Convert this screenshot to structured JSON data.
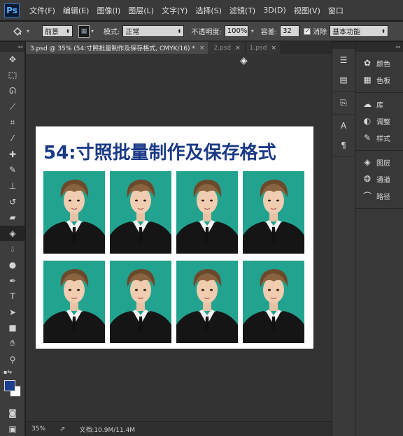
{
  "app": {
    "logo": "Ps",
    "menu": [
      "文件(F)",
      "编辑(E)",
      "图像(I)",
      "图层(L)",
      "文字(Y)",
      "选择(S)",
      "滤镜(T)",
      "3D(D)",
      "视图(V)",
      "窗口"
    ]
  },
  "options": {
    "tool_icon": "paint-bucket-icon",
    "fill_source": "前景",
    "mode_label": "模式:",
    "mode_value": "正常",
    "opacity_label": "不透明度:",
    "opacity_value": "100%",
    "tolerance_label": "容差:",
    "tolerance_value": "32",
    "antialias_label": "消除",
    "workspace": "基本功能"
  },
  "tabs": [
    {
      "label": "3.psd @ 35% (54:寸照批量制作及保存格式, CMYK/16) *",
      "close": "×",
      "active": true
    },
    {
      "label": "2.psd",
      "close": "×",
      "active": false
    },
    {
      "label": "1.psd",
      "close": "×",
      "active": false
    }
  ],
  "document": {
    "title": "54:寸照批量制作及保存格式",
    "photo_count": 8,
    "background_color": "#22a38f",
    "title_color": "#1a3a86"
  },
  "status": {
    "zoom": "35%",
    "doc_size": "文档:10.9M/11.4M"
  },
  "colors": {
    "foreground": "#1b3f8c",
    "background": "#ffffff"
  },
  "panels": {
    "group1": [
      {
        "icon": "palette-icon",
        "label": "颜色"
      },
      {
        "icon": "swatches-icon",
        "label": "色板"
      }
    ],
    "group2": [
      {
        "icon": "library-icon",
        "label": "库"
      },
      {
        "icon": "adjustments-icon",
        "label": "调整"
      },
      {
        "icon": "styles-icon",
        "label": "样式"
      }
    ],
    "group3": [
      {
        "icon": "layers-icon",
        "label": "图层"
      },
      {
        "icon": "channels-icon",
        "label": "通道"
      },
      {
        "icon": "paths-icon",
        "label": "路径"
      }
    ]
  }
}
